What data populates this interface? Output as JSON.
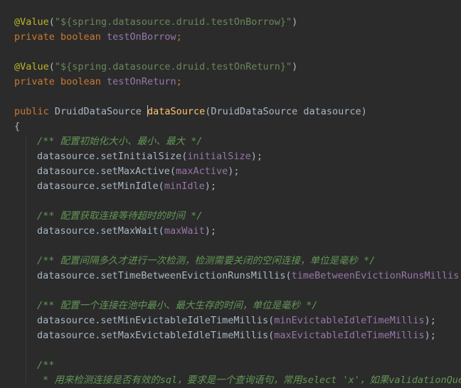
{
  "code": {
    "l1_ann": "@Value",
    "l1_open": "(",
    "l1_str": "\"${spring.datasource.druid.testOnBorrow}\"",
    "l1_close": ")",
    "l2_kw": "private boolean ",
    "l2_field": "testOnBorrow",
    "l2_end": ";",
    "l3_ann": "@Value",
    "l3_open": "(",
    "l3_str": "\"${spring.datasource.druid.testOnReturn}\"",
    "l3_close": ")",
    "l4_kw": "private boolean ",
    "l4_field": "testOnReturn",
    "l4_end": ";",
    "l5_kw": "public ",
    "l5_type": "DruidDataSource ",
    "l5_method": "dataSource",
    "l5_params": "(DruidDataSource datasource)",
    "l6_brace": "{",
    "c1": "/** 配置初始化大小、最小、最大 */",
    "s1_call": "datasource.setInitialSize(",
    "s1_arg": "initialSize",
    "s1_end": ");",
    "s2_call": "datasource.setMaxActive(",
    "s2_arg": "maxActive",
    "s2_end": ");",
    "s3_call": "datasource.setMinIdle(",
    "s3_arg": "minIdle",
    "s3_end": ");",
    "c2": "/** 配置获取连接等待超时的时间 */",
    "s4_call": "datasource.setMaxWait(",
    "s4_arg": "maxWait",
    "s4_end": ");",
    "c3": "/** 配置间隔多久才进行一次检测，检测需要关闭的空闲连接，单位是毫秒 */",
    "s5_call": "datasource.setTimeBetweenEvictionRunsMillis(",
    "s5_arg": "timeBetweenEvictionRunsMillis",
    "s5_end": ");",
    "c4": "/** 配置一个连接在池中最小、最大生存的时间，单位是毫秒 */",
    "s6_call": "datasource.setMinEvictableIdleTimeMillis(",
    "s6_arg": "minEvictableIdleTimeMillis",
    "s6_end": ");",
    "s7_call": "datasource.setMaxEvictableIdleTimeMillis(",
    "s7_arg": "maxEvictableIdleTimeMillis",
    "s7_end": ");",
    "c5_open": "/**",
    "c5_line": "* 用来检测连接是否有效的sql，要求是一个查询语句，常用select 'x'，如果validationQuery"
  },
  "colors": {
    "background": "#2b2b2b",
    "default_text": "#a9b7c6",
    "keyword": "#cc7832",
    "annotation": "#bbb529",
    "string": "#6a8759",
    "field": "#9876aa",
    "method_declaration": "#ffc66d",
    "doc_comment": "#629755"
  }
}
